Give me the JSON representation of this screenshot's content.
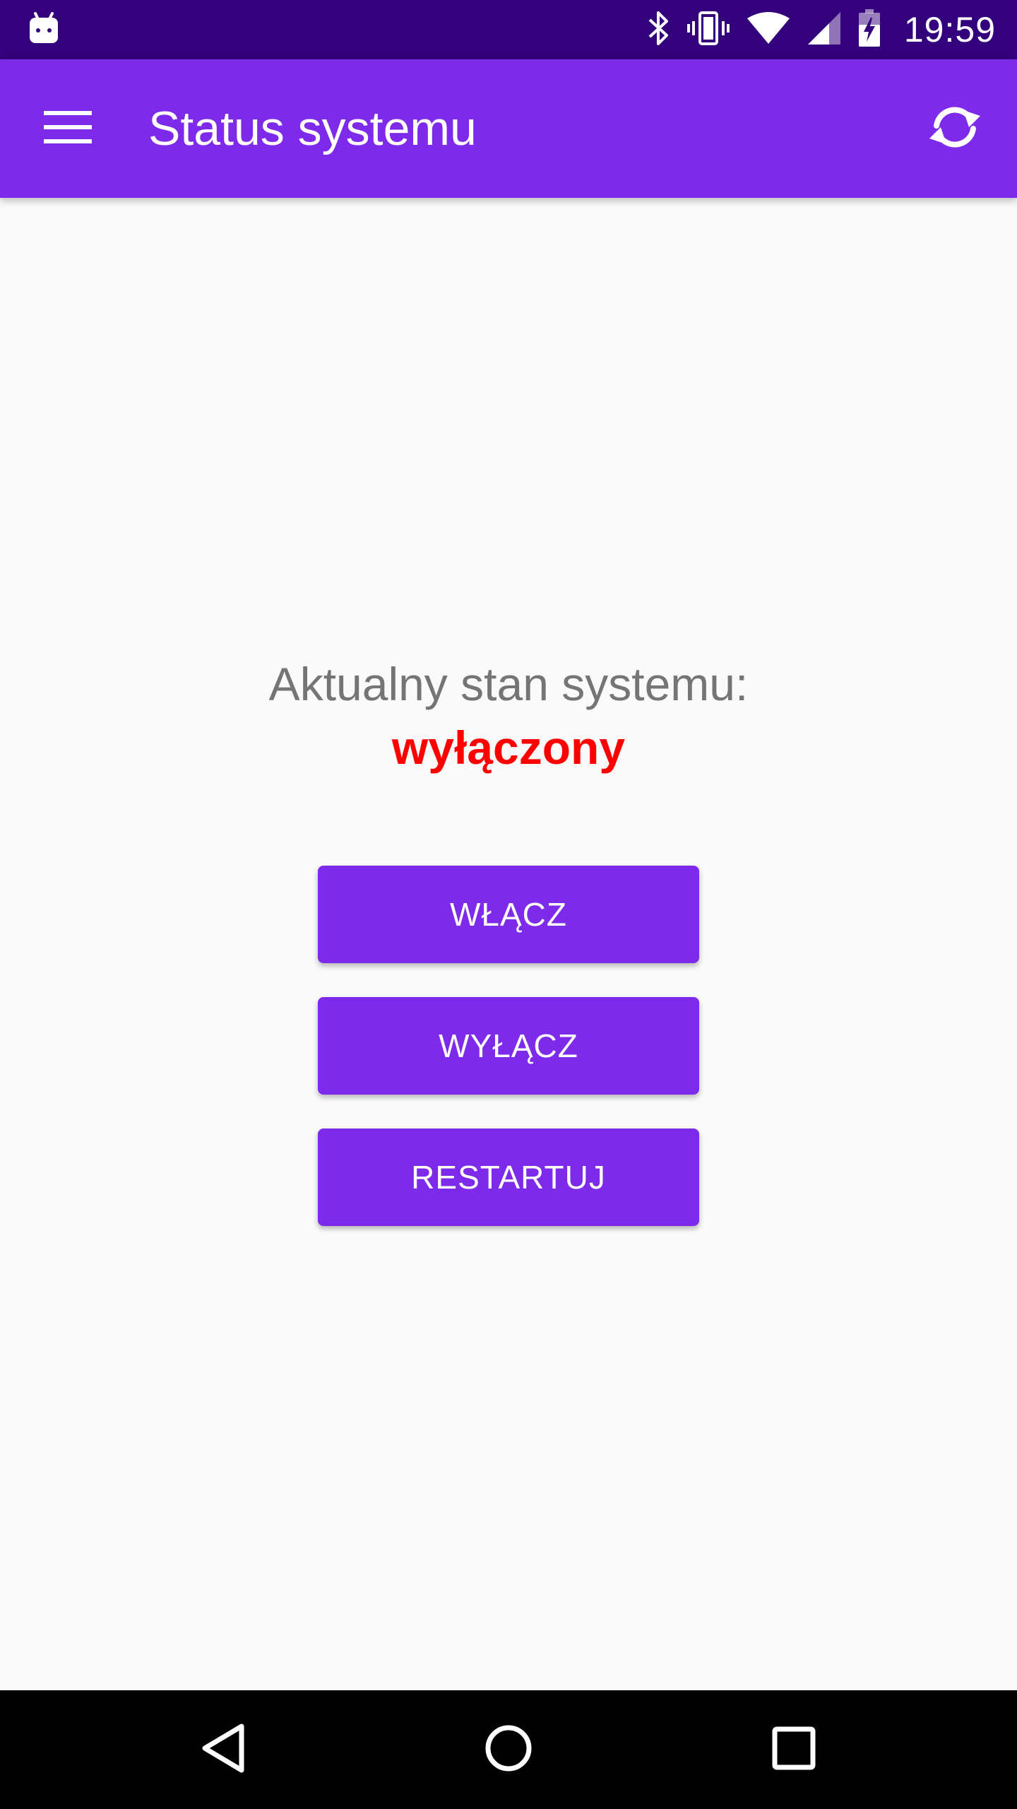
{
  "status_bar": {
    "time": "19:59",
    "icons": [
      "android-notification-icon",
      "bluetooth-icon",
      "vibrate-icon",
      "wifi-icon",
      "signal-icon",
      "battery-charging-icon"
    ]
  },
  "app_bar": {
    "title": "Status systemu",
    "menu_icon": "hamburger-menu-icon",
    "refresh_icon": "refresh-icon"
  },
  "main": {
    "status_label": "Aktualny stan systemu:",
    "status_value": "wyłączony",
    "status_color": "#ff0000",
    "buttons": {
      "on": "WŁĄCZ",
      "off": "WYŁĄCZ",
      "restart": "RESTARTUJ"
    }
  },
  "nav_bar": {
    "icons": [
      "back-icon",
      "home-icon",
      "recents-icon"
    ]
  },
  "colors": {
    "status_bar": "#33017b",
    "primary": "#7e2aeb",
    "background": "#fafafa",
    "label_text": "#757575"
  }
}
